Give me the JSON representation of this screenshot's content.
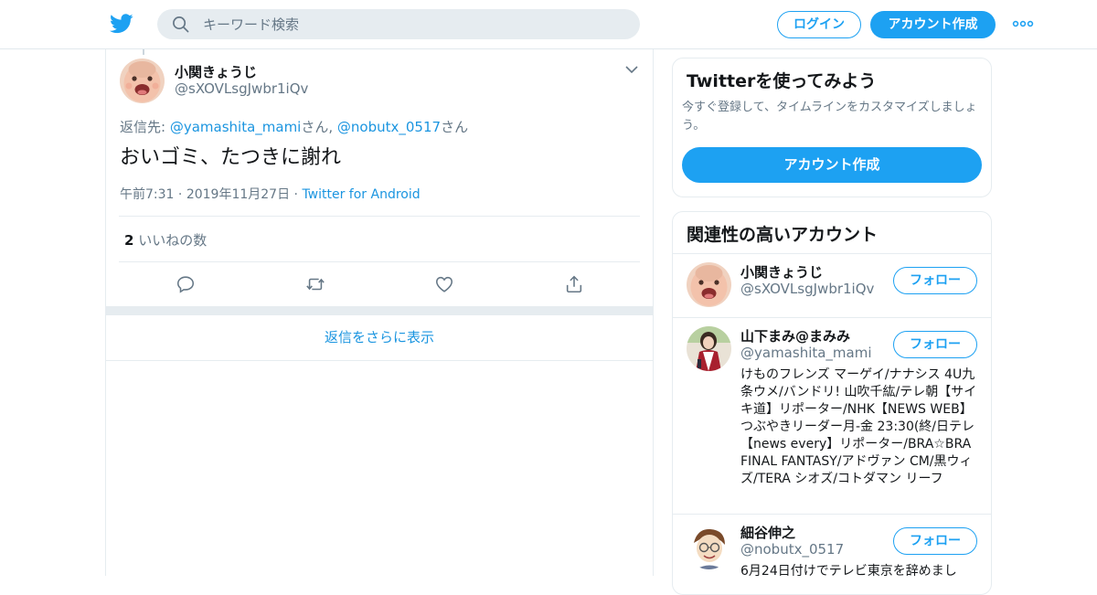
{
  "header": {
    "search_placeholder": "キーワード検索",
    "login_label": "ログイン",
    "signup_label": "アカウント作成"
  },
  "tweet": {
    "author_name": "小関きょうじ",
    "author_handle": "@sXOVLsgJwbr1iQv",
    "reply_prefix": "返信先: ",
    "reply_user1": "@yamashita_mami",
    "reply_sep": "さん, ",
    "reply_user2": "@nobutx_0517",
    "reply_suffix": "さん",
    "text": "おいゴミ、たつきに謝れ",
    "time": "午前7:31",
    "date": "2019年11月27日",
    "source": "Twitter for Android",
    "likes_count": "2",
    "likes_label": "いいねの数",
    "more_replies": "返信をさらに表示"
  },
  "signup_card": {
    "title": "Twitterを使ってみよう",
    "description": "今すぐ登録して、タイムラインをカスタマイズしましょう。",
    "button": "アカウント作成"
  },
  "related": {
    "title": "関連性の高いアカウント",
    "follow_label": "フォロー",
    "accounts": [
      {
        "name": "小関きょうじ",
        "handle": "@sXOVLsgJwbr1iQv",
        "bio": ""
      },
      {
        "name": "山下まみ@まみみ",
        "handle": "@yamashita_mami",
        "bio": "けものフレンズ マーゲイ/ナナシス 4U九条ウメ/バンドリ! 山吹千紘/テレ朝【サイキ道】リポーター/NHK【NEWS WEB】つぶやきリーダー月-金 23:30(終/日テレ【news every】リポーター/BRA☆BRA FINAL FANTASY/アドヴァン CM/黒ウィズ/TERA シオズ/コトダマン リーフ"
      },
      {
        "name": "細谷伸之",
        "handle": "@nobutx_0517",
        "bio": "6月24日付けでテレビ東京を辞めまし"
      }
    ]
  },
  "colors": {
    "accent": "#1da1f2",
    "link": "#1b95e0",
    "muted": "#657786"
  }
}
